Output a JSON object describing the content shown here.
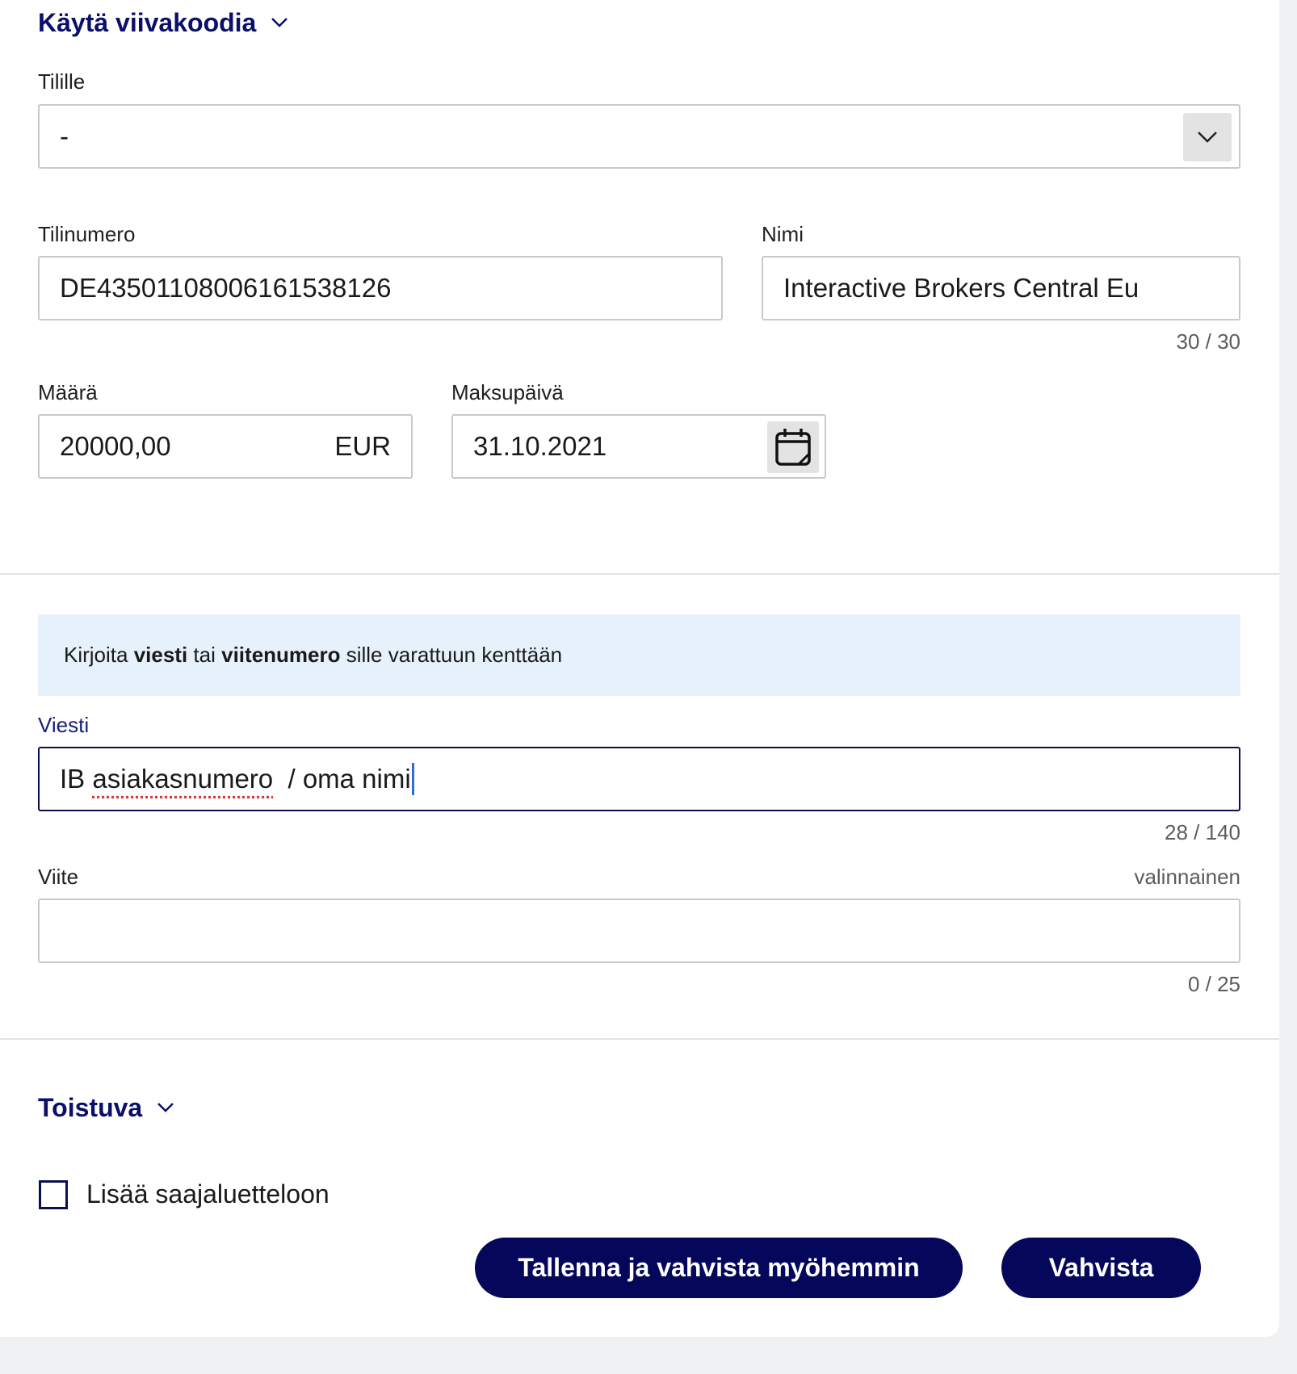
{
  "barcode": {
    "label": "Käytä viivakoodia"
  },
  "to_account": {
    "label": "Tilille",
    "value": "-"
  },
  "account_number": {
    "label": "Tilinumero",
    "value": "DE43501108006161538126"
  },
  "name": {
    "label": "Nimi",
    "value": "Interactive Brokers Central Eu",
    "counter": "30 / 30"
  },
  "amount": {
    "label": "Määrä",
    "value": "20000,00",
    "currency": "EUR"
  },
  "payment_date": {
    "label": "Maksupäivä",
    "value": "31.10.2021"
  },
  "info": {
    "part1": "Kirjoita ",
    "bold1": "viesti",
    "part2": " tai ",
    "bold2": "viitenumero",
    "part3": " sille varattuun kenttään"
  },
  "message": {
    "label": "Viesti",
    "value_prefix": "IB ",
    "value_misspelled": "asiakasnumero",
    "value_suffix": "  / oma nimi",
    "counter": "28 / 140"
  },
  "reference": {
    "label": "Viite",
    "optional": "valinnainen",
    "value": "",
    "counter": "0 / 25"
  },
  "recurring": {
    "label": "Toistuva"
  },
  "add_payee": {
    "label": "Lisää saajaluetteloon",
    "checked": false
  },
  "buttons": {
    "save_later": "Tallenna ja vahvista myöhemmin",
    "confirm": "Vahvista"
  },
  "colors": {
    "brand": "#05075a",
    "info_bg": "#e6f1fc",
    "page_bg": "#f0f1f3"
  }
}
